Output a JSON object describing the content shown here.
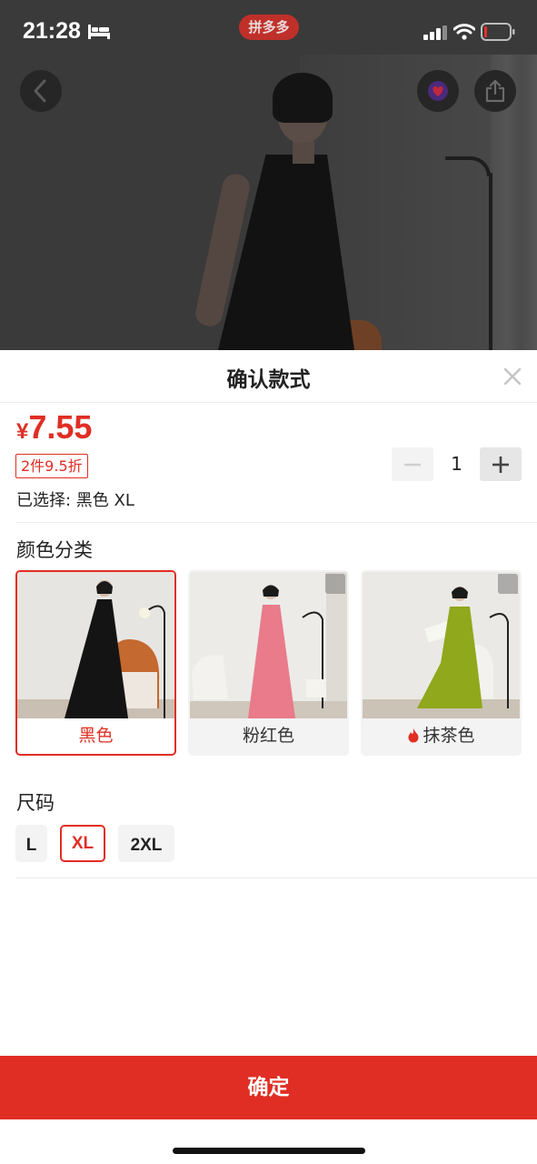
{
  "status_bar": {
    "time": "21:28",
    "brand": "拼多多",
    "icons": [
      "bed-icon",
      "signal-icon",
      "wifi-icon",
      "battery-icon"
    ]
  },
  "top_actions": {
    "icons": [
      "back-arrow-icon",
      "favorite-icon",
      "share-icon"
    ]
  },
  "sheet": {
    "title": "确认款式",
    "close_icon": "close-icon",
    "price_currency": "¥",
    "price_value": "7.55",
    "discount_tag": "2件9.5折",
    "selected_text": "已选择: 黑色 XL",
    "quantity": {
      "minus_icon": "minus-icon",
      "value": "1",
      "plus_icon": "plus-icon"
    },
    "color_section": {
      "title": "颜色分类",
      "options": [
        {
          "label": "黑色",
          "selected": true,
          "dress_color": "#111111"
        },
        {
          "label": "粉红色",
          "selected": false,
          "dress_color": "#e97b8a"
        },
        {
          "label": "抹茶色",
          "selected": false,
          "dress_color": "#8fa81c",
          "hot": true
        }
      ]
    },
    "size_section": {
      "title": "尺码",
      "options": [
        {
          "label": "L",
          "selected": false
        },
        {
          "label": "XL",
          "selected": true
        },
        {
          "label": "2XL",
          "selected": false
        }
      ]
    },
    "confirm_label": "确定"
  },
  "colors": {
    "accent": "#e02e24",
    "chip_bg": "#f3f3f3"
  }
}
